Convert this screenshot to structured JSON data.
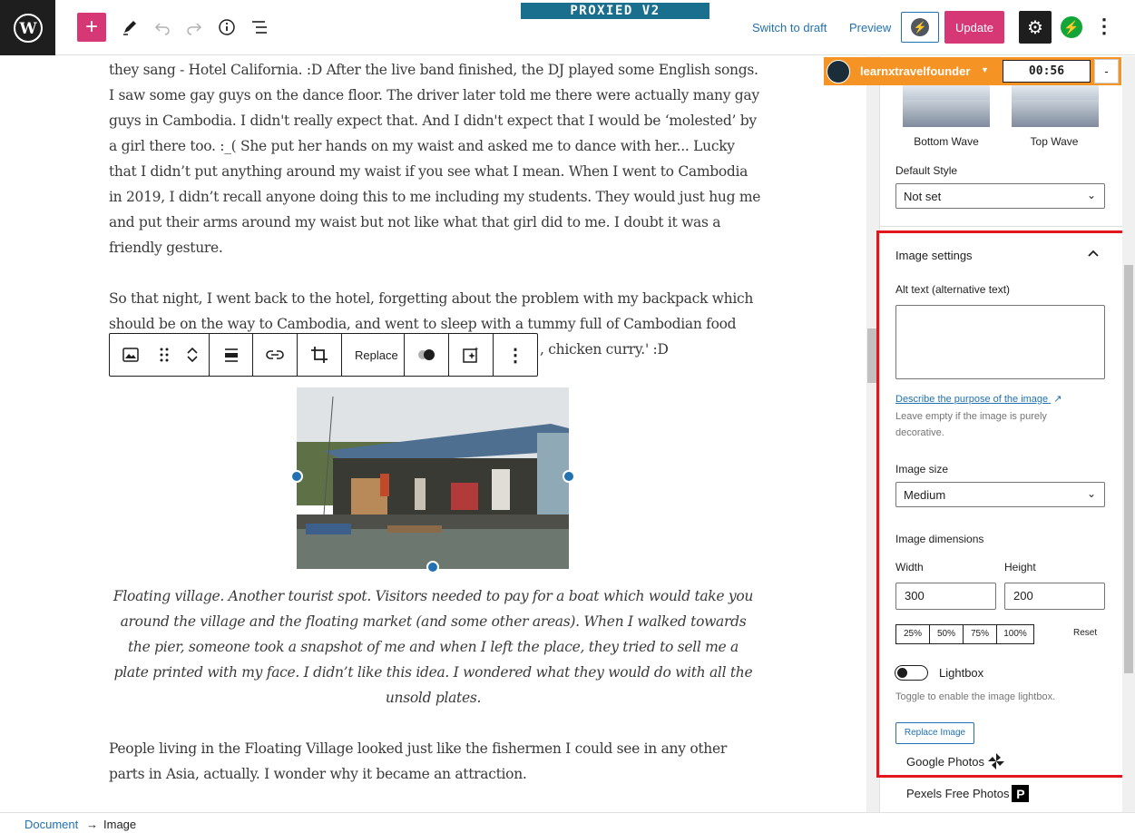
{
  "header": {
    "banner": "PROXIED V2",
    "switch_to_draft": "Switch to draft",
    "preview": "Preview",
    "update": "Update",
    "icons": [
      "wordpress-logo",
      "plus-icon",
      "pencil-icon",
      "undo-icon",
      "redo-icon",
      "info-icon",
      "list-view-icon",
      "bolt-icon",
      "gear-icon",
      "jetpack-icon",
      "kebab-icon"
    ]
  },
  "overlay": {
    "account": "learnxtravelfounder",
    "timer": "00:56",
    "minus": "-"
  },
  "content": {
    "paragraph1": "they sang - Hotel California. :D After the live band finished, the DJ played some English songs. I saw some gay guys on the dance floor. The driver later told me there were actually many gay guys in Cambodia. I didn't really expect that.  And I didn't expect that I would be ‘molested’ by a girl there too.   :_(   She put her hands on my waist and asked me to dance with her... Lucky that I didn’t put anything around my waist if you see what I mean. When I went to Cambodia in 2019, I didn’t recall anyone doing this to me including my students. They would just hug me and put their arms around my waist but not like what that girl did to me. I doubt it was a friendly gesture.",
    "paragraph2_line1": "So that night, I went back to the hotel, forgetting about the problem with my backpack which",
    "paragraph2_line2": "should be on the way to Cambodia, and went to sleep with a tummy full of Cambodian food",
    "paragraph2_line3_tail": ", chicken curry.' :D",
    "caption": "Floating village. Another tourist spot. Visitors needed to pay for a boat which would take you around the village and the floating market (and some other areas). When I walked towards the pier, someone took a snapshot of me and when I left the place, they tried to sell me a plate printed with my face. I didn’t like this idea. I wondered what they would do with all the unsold plates.",
    "paragraph3": "People living in the Floating Village looked just like the fishermen I could see in any other parts in Asia, actually. I wonder why it became an attraction."
  },
  "block_toolbar": {
    "replace": "Replace"
  },
  "sidebar": {
    "bottom_wave": "Bottom Wave",
    "top_wave": "Top Wave",
    "default_style_label": "Default Style",
    "default_style_value": "Not set",
    "image_settings_title": "Image settings",
    "alt_text_label": "Alt text (alternative text)",
    "describe_link": "Describe the purpose of the image",
    "alt_help": "Leave empty if the image is purely decorative.",
    "image_size_label": "Image size",
    "image_size_value": "Medium",
    "image_dimensions_label": "Image dimensions",
    "width_label": "Width",
    "height_label": "Height",
    "width_value": "300",
    "height_value": "200",
    "percents": [
      "25%",
      "50%",
      "75%",
      "100%"
    ],
    "reset": "Reset",
    "lightbox_label": "Lightbox",
    "lightbox_help": "Toggle to enable the image lightbox.",
    "replace_image": "Replace Image",
    "google_photos": "Google Photos",
    "pexels": "Pexels Free Photos"
  },
  "footer": {
    "document": "Document",
    "arrow": "→",
    "image": "Image"
  }
}
